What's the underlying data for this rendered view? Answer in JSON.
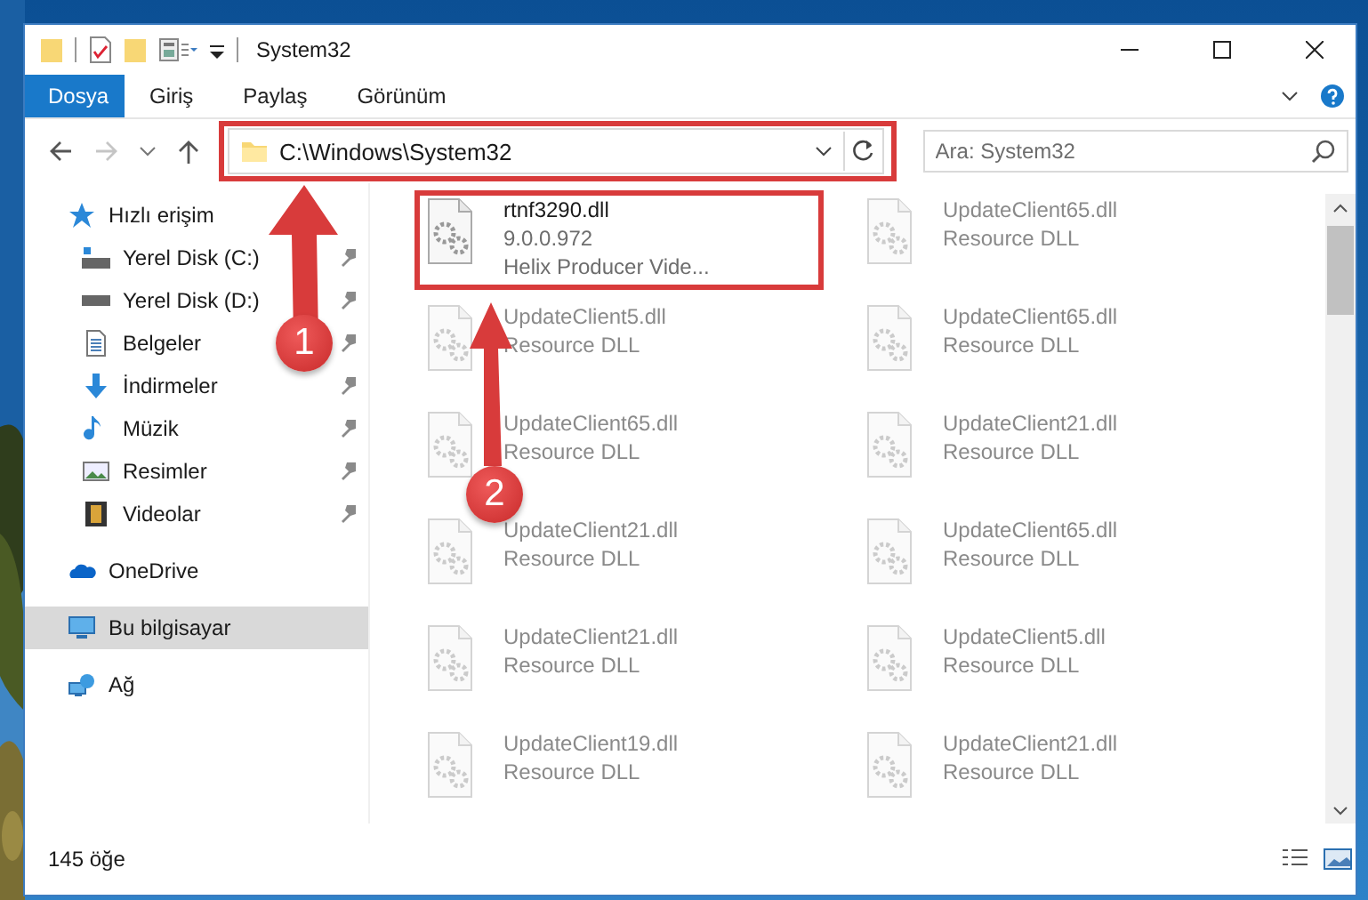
{
  "window": {
    "title": "System32"
  },
  "ribbon_tabs": [
    {
      "label": "Dosya",
      "selected": true
    },
    {
      "label": "Giriş",
      "selected": false
    },
    {
      "label": "Paylaş",
      "selected": false
    },
    {
      "label": "Görünüm",
      "selected": false
    }
  ],
  "address_bar": {
    "path": "C:\\Windows\\System32",
    "highlighted": true
  },
  "search": {
    "placeholder": "Ara: System32"
  },
  "sidebar": {
    "items": [
      {
        "label": "Hızlı erişim",
        "selected": false,
        "children": [
          {
            "label": "Yerel Disk (C:)",
            "pinned": true,
            "selected": false
          },
          {
            "label": "Yerel Disk (D:)",
            "pinned": true,
            "selected": false
          },
          {
            "label": "Belgeler",
            "pinned": true,
            "selected": false
          },
          {
            "label": "İndirmeler",
            "pinned": true,
            "selected": false
          },
          {
            "label": "Müzik",
            "pinned": true,
            "selected": false
          },
          {
            "label": "Resimler",
            "pinned": true,
            "selected": false
          },
          {
            "label": "Videolar",
            "pinned": true,
            "selected": false
          }
        ]
      },
      {
        "label": "OneDrive",
        "selected": false
      },
      {
        "label": "Bu bilgisayar",
        "selected": true
      },
      {
        "label": "Ağ",
        "selected": false
      }
    ]
  },
  "files": [
    {
      "name": "rtnf3290.dll",
      "version": "9.0.0.972",
      "description": "Helix Producer Vide...",
      "dimmed": false,
      "highlighted": true
    },
    {
      "name": "UpdateClient65.dll",
      "description": "Resource DLL",
      "dimmed": true,
      "highlighted": false
    },
    {
      "name": "UpdateClient5.dll",
      "description": "Resource DLL",
      "dimmed": true,
      "highlighted": false
    },
    {
      "name": "UpdateClient65.dll",
      "description": "Resource DLL",
      "dimmed": true,
      "highlighted": false
    },
    {
      "name": "UpdateClient65.dll",
      "description": "Resource DLL",
      "dimmed": true,
      "highlighted": false
    },
    {
      "name": "UpdateClient21.dll",
      "description": "Resource DLL",
      "dimmed": true,
      "highlighted": false
    },
    {
      "name": "UpdateClient21.dll",
      "description": "Resource DLL",
      "dimmed": true,
      "highlighted": false
    },
    {
      "name": "UpdateClient65.dll",
      "description": "Resource DLL",
      "dimmed": true,
      "highlighted": false
    },
    {
      "name": "UpdateClient21.dll",
      "description": "Resource DLL",
      "dimmed": true,
      "highlighted": false
    },
    {
      "name": "UpdateClient5.dll",
      "description": "Resource DLL",
      "dimmed": true,
      "highlighted": false
    },
    {
      "name": "UpdateClient19.dll",
      "description": "Resource DLL",
      "dimmed": true,
      "highlighted": false
    },
    {
      "name": "UpdateClient21.dll",
      "description": "Resource DLL",
      "dimmed": true,
      "highlighted": false
    }
  ],
  "status_bar": {
    "item_count": "145 öğe"
  },
  "callouts": [
    {
      "number": "1"
    },
    {
      "number": "2"
    }
  ]
}
